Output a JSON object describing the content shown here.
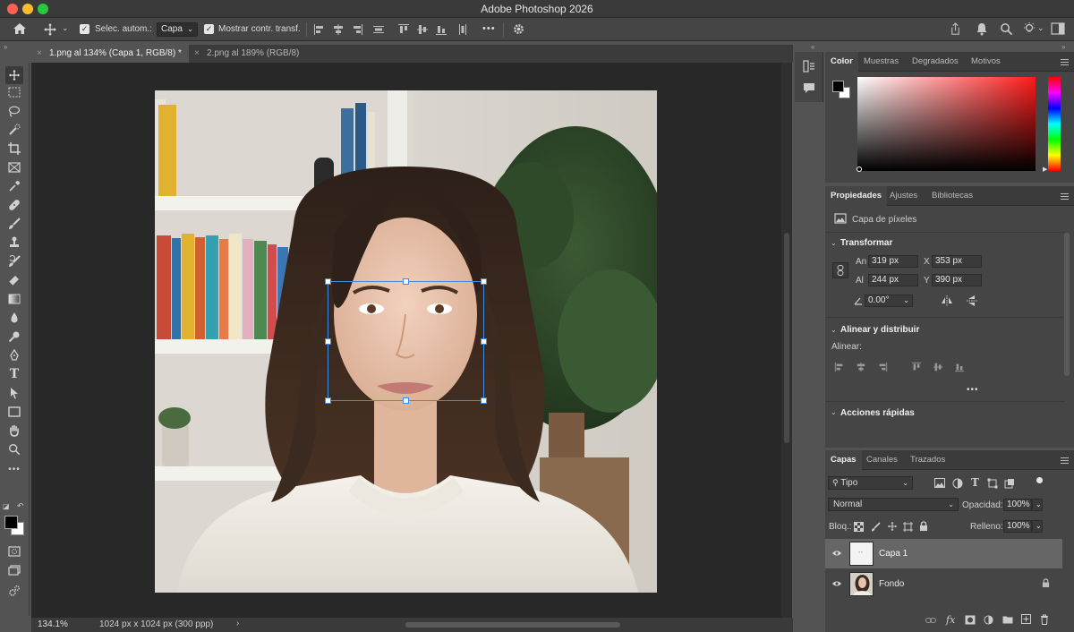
{
  "app": {
    "title": "Adobe Photoshop 2026"
  },
  "options_bar": {
    "auto_select_label": "Selec. autom.:",
    "auto_select_value": "Capa",
    "show_transform_label": "Mostrar contr. transf.",
    "more_label": "•••"
  },
  "tabs": [
    {
      "label": "1.png al 134% (Capa 1, RGB/8) *"
    },
    {
      "label": "2.png al 189% (RGB/8)"
    }
  ],
  "status": {
    "zoom": "134.1%",
    "doc_info": "1024 px x 1024 px (300 ppp)"
  },
  "color_panel": {
    "tabs": [
      "Color",
      "Muestras",
      "Degradados",
      "Motivos"
    ],
    "foreground": "#000000",
    "background": "#ffffff",
    "hue": "#ff1a1a"
  },
  "properties_panel": {
    "tabs": [
      "Propiedades",
      "Ajustes",
      "Bibliotecas"
    ],
    "layer_type": "Capa de píxeles",
    "transform": {
      "title": "Transformar",
      "width_label": "An",
      "width": "319 px",
      "height_label": "Al",
      "height": "244 px",
      "x_label": "X",
      "x": "353 px",
      "y_label": "Y",
      "y": "390 px",
      "angle": "0.00°"
    },
    "align": {
      "title": "Alinear y distribuir",
      "label": "Alinear:",
      "more": "•••"
    },
    "quick_actions": {
      "title": "Acciones rápidas"
    }
  },
  "layers_panel": {
    "tabs": [
      "Capas",
      "Canales",
      "Trazados"
    ],
    "filter": "Tipo",
    "blend_mode": "Normal",
    "opacity_label": "Opacidad:",
    "opacity": "100%",
    "lock_label": "Bloq.:",
    "fill_label": "Relleno:",
    "fill": "100%",
    "layers": [
      {
        "name": "Capa 1",
        "selected": true
      },
      {
        "name": "Fondo",
        "locked": true
      }
    ]
  }
}
